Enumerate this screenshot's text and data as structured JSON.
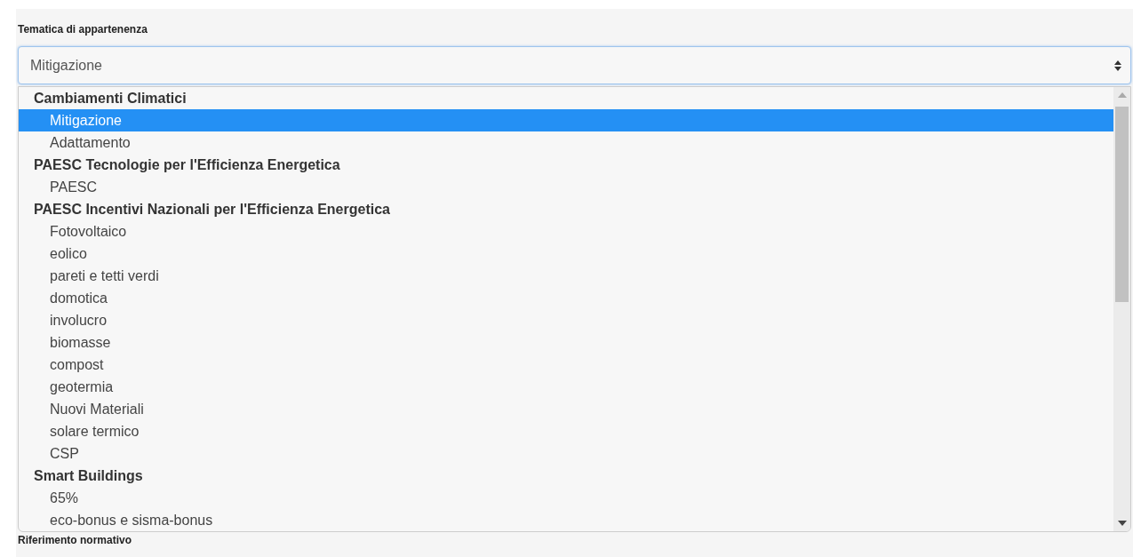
{
  "field": {
    "label": "Tematica di appartenenza",
    "value": "Mitigazione"
  },
  "dropdown": {
    "groups": [
      {
        "label": "Cambiamenti Climatici",
        "options": [
          {
            "label": "Mitigazione",
            "selected": true
          },
          {
            "label": "Adattamento",
            "selected": false
          }
        ]
      },
      {
        "label": "PAESC Tecnologie per l'Efficienza Energetica",
        "options": [
          {
            "label": "PAESC",
            "selected": false
          }
        ]
      },
      {
        "label": "PAESC Incentivi Nazionali per l'Efficienza Energetica",
        "options": [
          {
            "label": "Fotovoltaico",
            "selected": false
          },
          {
            "label": "eolico",
            "selected": false
          },
          {
            "label": "pareti e tetti verdi",
            "selected": false
          },
          {
            "label": "domotica",
            "selected": false
          },
          {
            "label": "involucro",
            "selected": false
          },
          {
            "label": "biomasse",
            "selected": false
          },
          {
            "label": "compost",
            "selected": false
          },
          {
            "label": "geotermia",
            "selected": false
          },
          {
            "label": "Nuovi Materiali",
            "selected": false
          },
          {
            "label": "solare termico",
            "selected": false
          },
          {
            "label": "CSP",
            "selected": false
          }
        ]
      },
      {
        "label": "Smart Buildings",
        "options": [
          {
            "label": "65%",
            "selected": false
          },
          {
            "label": "eco-bonus e sisma-bonus",
            "selected": false
          }
        ]
      }
    ]
  },
  "next_field": {
    "label": "Riferimento normativo"
  }
}
